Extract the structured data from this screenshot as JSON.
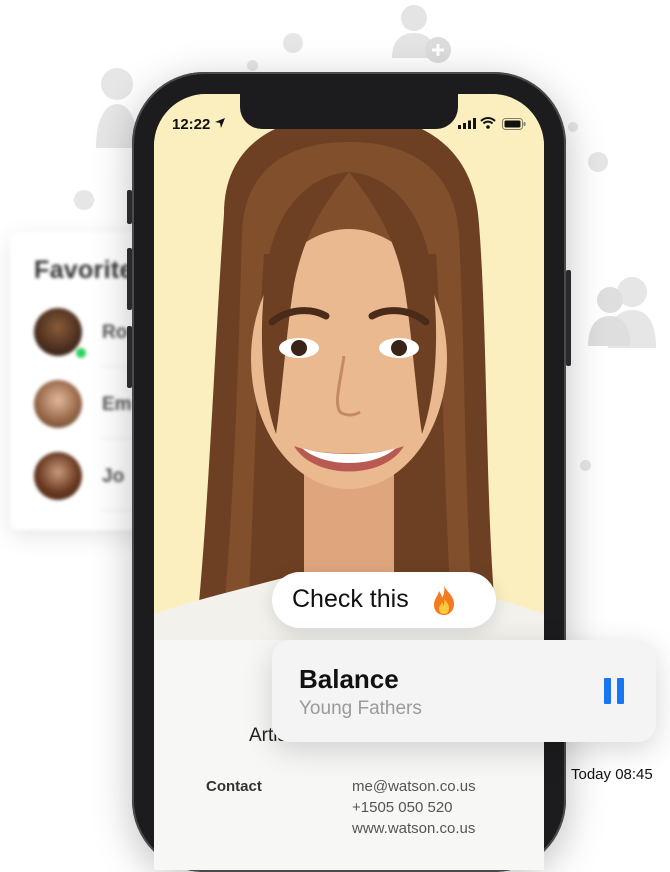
{
  "status_bar": {
    "time": "12:22",
    "location_icon": "location-arrow-icon",
    "signal_icon": "cellular-signal-icon",
    "wifi_icon": "wifi-icon",
    "battery_icon": "battery-icon"
  },
  "favorites": {
    "title": "Favorite",
    "items": [
      {
        "name": "Ro",
        "online": true
      },
      {
        "name": "Em",
        "online": false
      },
      {
        "name": "Jo",
        "online": false
      }
    ]
  },
  "profile": {
    "artist_label": "Artis",
    "contact_label": "Contact",
    "email": "me@watson.co.us",
    "phone": "+1505 050 520",
    "website": "www.watson.co.us"
  },
  "message": {
    "text": "Check this",
    "emoji": "fire-emoji"
  },
  "now_playing": {
    "title": "Balance",
    "artist": "Young Fathers",
    "control": "pause-icon",
    "accent": "#1976f2"
  },
  "timestamp": "Today 08:45"
}
